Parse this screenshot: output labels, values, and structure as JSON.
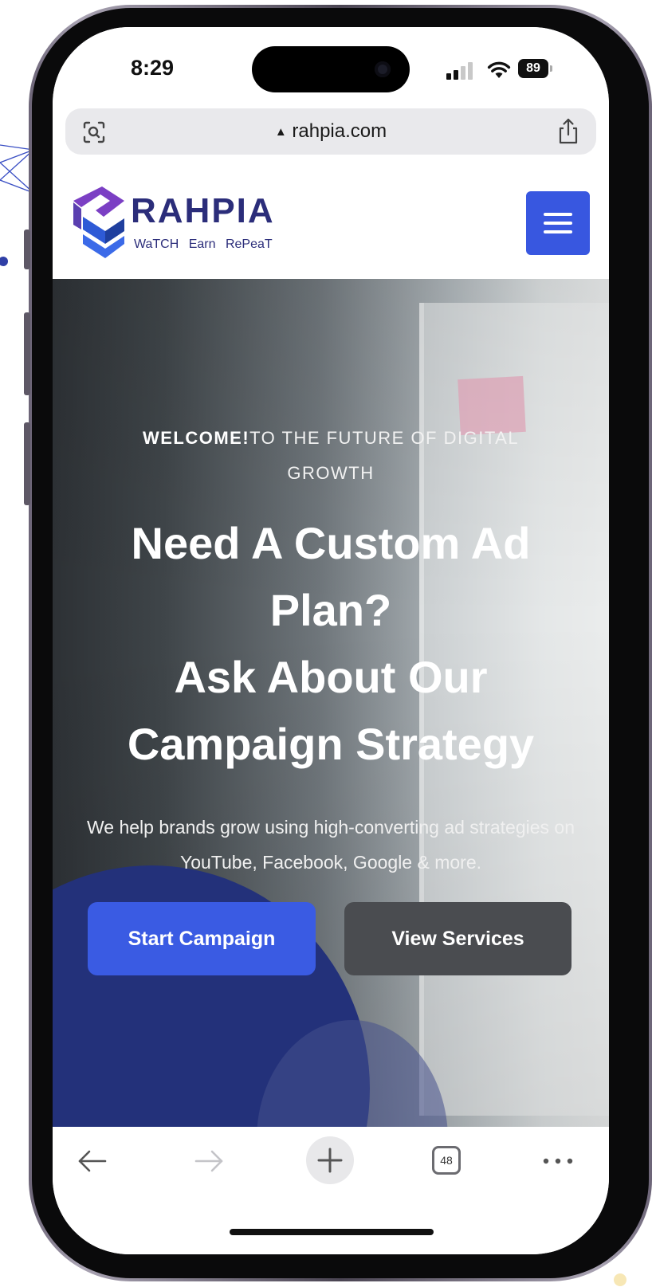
{
  "status_bar": {
    "time": "8:29",
    "battery": "89"
  },
  "browser": {
    "url": "rahpia.com",
    "open_tabs": "48"
  },
  "site": {
    "brand": "RAHPIA",
    "tagline": "WaTCH  Earn  RePeaT"
  },
  "hero": {
    "kicker_bold": "WELCOME!",
    "kicker_rest": "TO THE FUTURE OF DIGITAL GROWTH",
    "title_line1": "Need A Custom Ad Plan?",
    "title_line2": "Ask About Our Campaign Strategy",
    "description": "We help brands grow using high-converting ad strategies on YouTube, Facebook, Google & more.",
    "primary_button": "Start Campaign",
    "secondary_button": "View Services"
  },
  "colors": {
    "accent": "#3a5be3",
    "brand_navy": "#2b2d7a",
    "brand_purple": "#7b3fc4",
    "secondary_button": "#4a4c50"
  },
  "icons": {
    "url_left": "visual-search-icon",
    "url_right": "share-icon",
    "nav_back": "arrow-left-icon",
    "nav_forward": "arrow-right-icon",
    "new_tab": "plus-icon",
    "tabs": "tabs-count-icon",
    "more": "ellipsis-icon",
    "menu": "hamburger-icon"
  }
}
